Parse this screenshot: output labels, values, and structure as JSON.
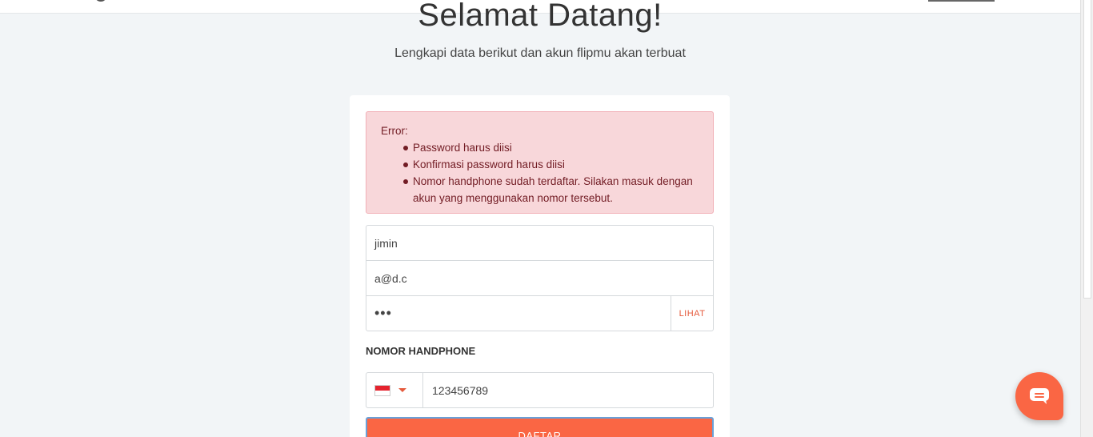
{
  "header": {
    "title": "Selamat Datang!",
    "subtitle": "Lengkapi data berikut dan akun flipmu akan terbuat"
  },
  "alert": {
    "heading": "Error:",
    "items": [
      "Password harus diisi",
      "Konfirmasi password harus diisi",
      "Nomor handphone sudah terdaftar. Silakan masuk dengan akun yang menggunakan nomor tersebut."
    ]
  },
  "form": {
    "name_value": "jimin",
    "email_value": "a@d.c",
    "password_mask": "•••",
    "show_password_label": "LIHAT",
    "phone_label": "NOMOR HANDPHONE",
    "phone_country_flag": "indonesia-flag",
    "phone_value": "123456789",
    "submit_label": "DAFTAR"
  },
  "colors": {
    "accent": "#fa6644",
    "error_bg": "#f8d7da",
    "error_text": "#721c24",
    "page_bg": "#f2f5f7"
  },
  "icons": {
    "chat": "chat-bubble-icon",
    "dropdown": "caret-down-icon"
  }
}
